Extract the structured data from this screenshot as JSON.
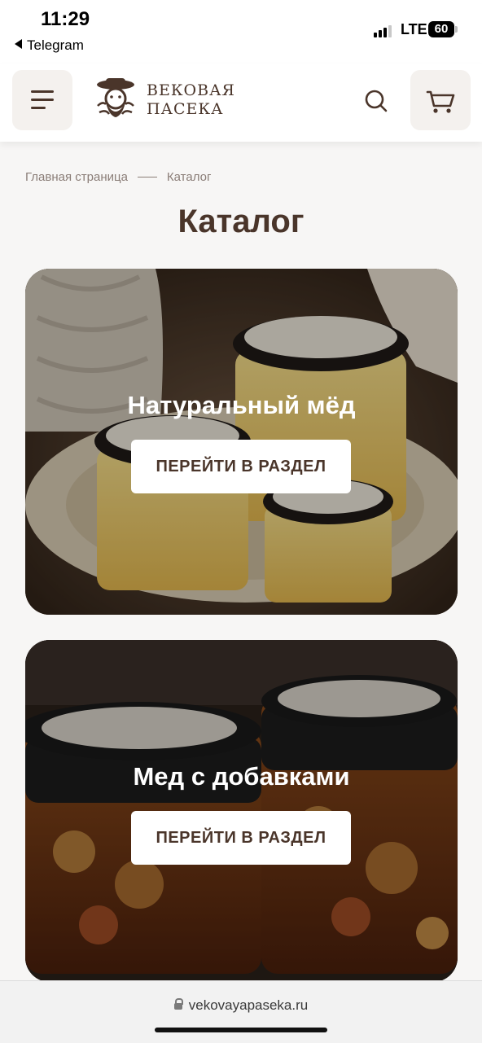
{
  "status_bar": {
    "time": "11:29",
    "back_app": "Telegram",
    "network": "LTE",
    "battery": "60"
  },
  "header": {
    "logo_line1": "ВЕКОВАЯ",
    "logo_line2": "ПАСЕКА",
    "menu_icon": "hamburger-menu-icon",
    "search_icon": "search-icon",
    "cart_icon": "cart-icon"
  },
  "breadcrumb": {
    "home": "Главная страница",
    "current": "Каталог"
  },
  "page": {
    "title": "Каталог"
  },
  "categories": [
    {
      "title": "Натуральный мёд",
      "button": "ПЕРЕЙТИ В РАЗДЕЛ"
    },
    {
      "title": "Мед с добавками",
      "button": "ПЕРЕЙТИ В РАЗДЕЛ"
    }
  ],
  "browser": {
    "url": "vekovayapaseka.ru"
  },
  "colors": {
    "brand_brown": "#4a352a",
    "muted_text": "#8a7d77",
    "page_background": "#f7f6f5"
  }
}
